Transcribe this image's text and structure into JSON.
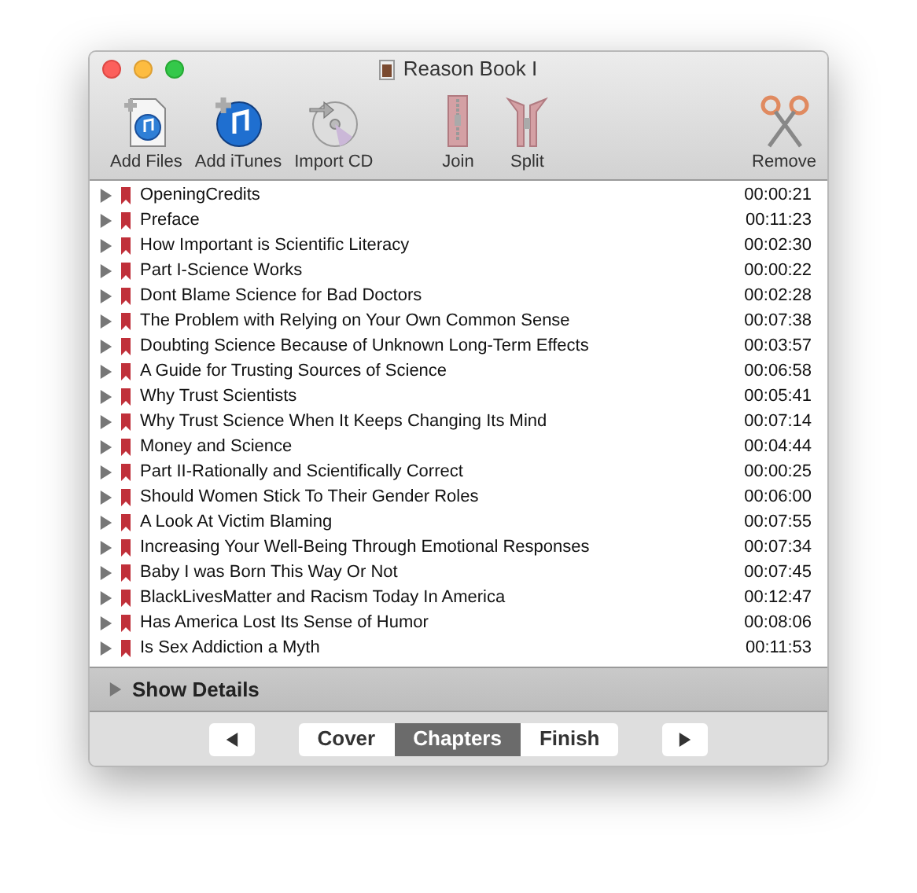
{
  "window": {
    "title": "Reason Book I"
  },
  "toolbar": [
    {
      "label": "Add Files"
    },
    {
      "label": "Add iTunes"
    },
    {
      "label": "Import CD"
    },
    {
      "label": "Join"
    },
    {
      "label": "Split"
    },
    {
      "label": "Remove"
    }
  ],
  "chapters": [
    {
      "name": "OpeningCredits",
      "duration": "00:00:21",
      "expanded": false
    },
    {
      "name": "Preface",
      "duration": "00:11:23",
      "expanded": false
    },
    {
      "name": "How Important is Scientific Literacy",
      "duration": "00:02:30",
      "expanded": false
    },
    {
      "name": "Part I-Science Works",
      "duration": "00:00:22",
      "expanded": false
    },
    {
      "name": "Dont Blame Science for Bad Doctors",
      "duration": "00:02:28",
      "expanded": false
    },
    {
      "name": "The Problem with Relying on Your Own Common Sense",
      "duration": "00:07:38",
      "expanded": false
    },
    {
      "name": "Doubting Science Because of Unknown Long-Term Effects",
      "duration": "00:03:57",
      "expanded": false
    },
    {
      "name": "A Guide for Trusting Sources of Science",
      "duration": "00:06:58",
      "expanded": false
    },
    {
      "name": "Why Trust Scientists",
      "duration": "00:05:41",
      "expanded": false
    },
    {
      "name": "Why Trust Science When It Keeps Changing Its Mind",
      "duration": "00:07:14",
      "expanded": false
    },
    {
      "name": "Money and Science",
      "duration": "00:04:44",
      "expanded": false
    },
    {
      "name": "Part II-Rationally and Scientifically Correct",
      "duration": "00:00:25",
      "expanded": false
    },
    {
      "name": "Should Women Stick To Their Gender Roles",
      "duration": "00:06:00",
      "expanded": false
    },
    {
      "name": "A Look At Victim Blaming",
      "duration": "00:07:55",
      "expanded": false
    },
    {
      "name": "Increasing Your Well-Being Through Emotional Responses",
      "duration": "00:07:34",
      "expanded": false
    },
    {
      "name": "Baby I was Born This Way Or Not",
      "duration": "00:07:45",
      "expanded": false
    },
    {
      "name": "BlackLivesMatter and Racism Today In America",
      "duration": "00:12:47",
      "expanded": false
    },
    {
      "name": "Has America Lost Its Sense of Humor",
      "duration": "00:08:06",
      "expanded": false
    },
    {
      "name": "Is Sex Addiction a Myth",
      "duration": "00:11:53",
      "expanded": false
    }
  ],
  "details": {
    "label": "Show Details",
    "expanded": false
  },
  "steps": [
    {
      "label": "Cover",
      "selected": false
    },
    {
      "label": "Chapters",
      "selected": true
    },
    {
      "label": "Finish",
      "selected": false
    }
  ]
}
